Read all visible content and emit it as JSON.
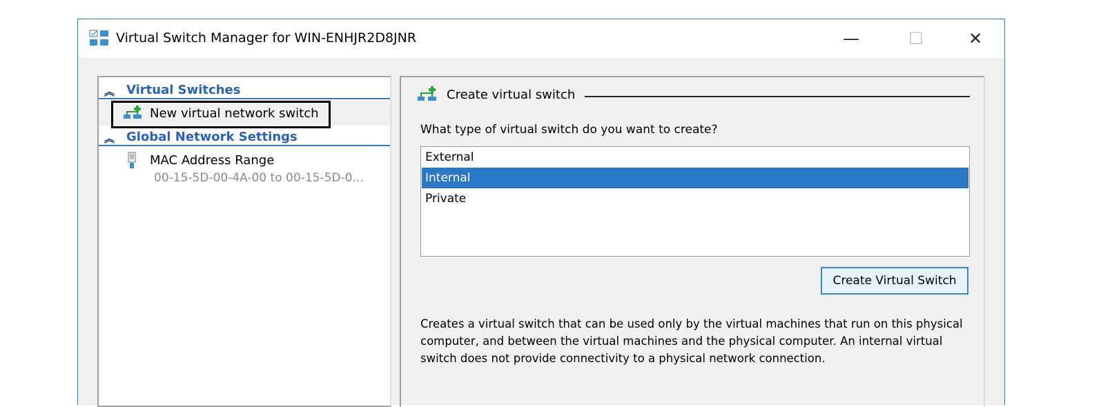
{
  "window": {
    "title": "Virtual Switch Manager for WIN-ENHJR2D8JNR",
    "minimize": "—",
    "maximize": "☐",
    "close": "✕"
  },
  "sidebar": {
    "virtual_switches": "Virtual Switches",
    "new_switch": "New virtual network switch",
    "global_settings": "Global Network Settings",
    "mac_range": "MAC Address Range",
    "mac_value": "00-15-5D-00-4A-00 to 00-15-5D-0..."
  },
  "main": {
    "section_title": "Create virtual switch",
    "question": "What type of virtual switch do you want to create?",
    "options": [
      "External",
      "Internal",
      "Private"
    ],
    "selected": "Internal",
    "create_button": "Create Virtual Switch",
    "description": "Creates a virtual switch that can be used only by the virtual machines that run on this physical computer, and between the virtual machines and the physical computer. An internal virtual switch does not provide connectivity to a physical network connection."
  },
  "colors": {
    "accent": "#2a77c6",
    "header": "#2a62b5"
  }
}
